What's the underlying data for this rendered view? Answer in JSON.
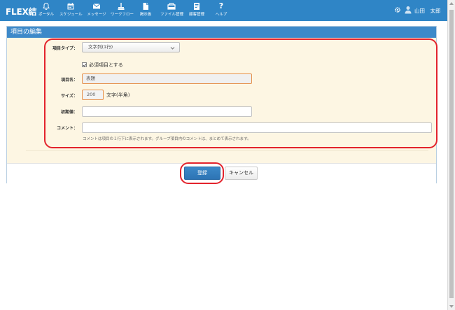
{
  "app": {
    "logo": "FLEX結"
  },
  "nav": [
    {
      "label": "ポータル",
      "icon": "bell-icon"
    },
    {
      "label": "スケジュール",
      "icon": "calendar-icon"
    },
    {
      "label": "メッセージ",
      "icon": "envelope-icon"
    },
    {
      "label": "ワークフロー",
      "icon": "workflow-icon"
    },
    {
      "label": "掲示板",
      "icon": "board-icon"
    },
    {
      "label": "ファイル管理",
      "icon": "folder-icon"
    },
    {
      "label": "顧客管理",
      "icon": "customer-icon"
    },
    {
      "label": "ヘルプ",
      "icon": "help-icon"
    }
  ],
  "user": {
    "name": "山田　太郎"
  },
  "panel": {
    "title": "項目の編集"
  },
  "form": {
    "type_label": "項目タイプ：",
    "type_value": "文字列(1行)",
    "required_label": "必須項目とする",
    "required_checked": true,
    "name_label": "項目名：",
    "name_value": "表題",
    "size_label": "サイズ：",
    "size_value": "200",
    "size_suffix": "文字(半角)",
    "default_label": "初期値：",
    "default_value": "",
    "comment_label": "コメント：",
    "comment_value": "",
    "comment_hint": "コメントは項目の１行下に表示されます。グループ項目内のコメントは、まとめて表示されます。"
  },
  "buttons": {
    "save": "登録",
    "cancel": "キャンセル"
  },
  "colors": {
    "topbar": "#2f85c6",
    "panel_header": "#3d89c9",
    "form_bg": "#fdf6e3",
    "highlight": "#e3232c"
  }
}
